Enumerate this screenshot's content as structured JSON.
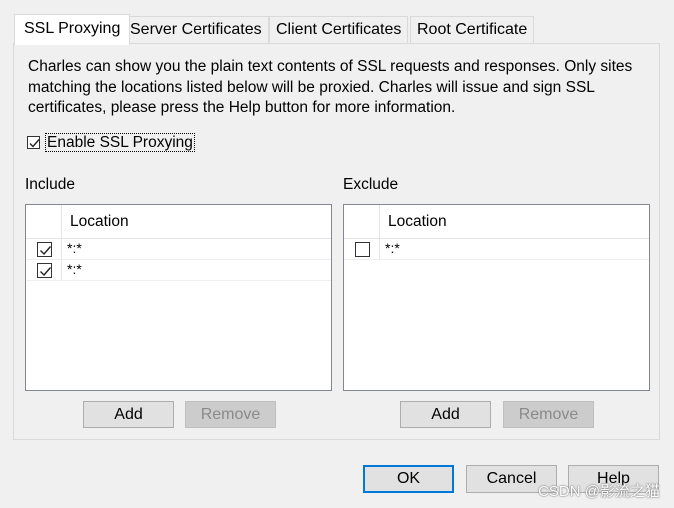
{
  "tabs": [
    {
      "label": "SSL Proxying",
      "active": true
    },
    {
      "label": "Server Certificates",
      "active": false
    },
    {
      "label": "Client Certificates",
      "active": false
    },
    {
      "label": "Root Certificate",
      "active": false
    }
  ],
  "description": "Charles can show you the plain text contents of SSL requests and responses. Only sites matching the locations listed below will be proxied. Charles will issue and sign SSL certificates, please press the Help button for more information.",
  "enable_ssl": {
    "label": "Enable SSL Proxying",
    "checked": true
  },
  "include": {
    "title": "Include",
    "column": "Location",
    "rows": [
      {
        "location": "*:*",
        "checked": true
      },
      {
        "location": "*:*",
        "checked": true
      }
    ],
    "add_label": "Add",
    "remove_label": "Remove"
  },
  "exclude": {
    "title": "Exclude",
    "column": "Location",
    "rows": [
      {
        "location": "*:*",
        "checked": false
      }
    ],
    "add_label": "Add",
    "remove_label": "Remove"
  },
  "footer": {
    "ok_label": "OK",
    "cancel_label": "Cancel",
    "help_label": "Help"
  },
  "watermark": "CSDN @影流之猫",
  "colors": {
    "focus_border": "#0078d7",
    "window_bg": "#f0f0f0"
  }
}
